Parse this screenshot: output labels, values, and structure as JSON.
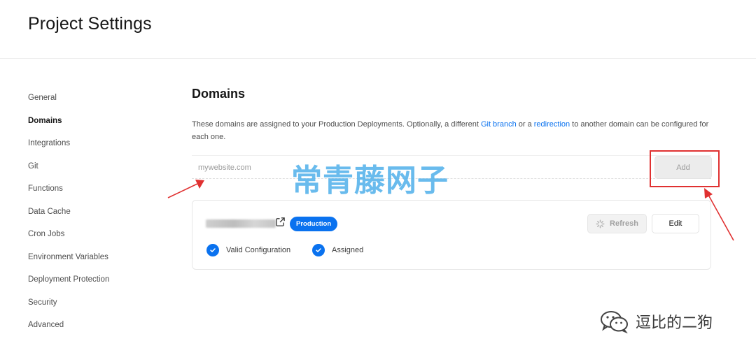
{
  "header": {
    "title": "Project Settings"
  },
  "sidebar": {
    "items": [
      {
        "label": "General"
      },
      {
        "label": "Domains",
        "active": true
      },
      {
        "label": "Integrations"
      },
      {
        "label": "Git"
      },
      {
        "label": "Functions"
      },
      {
        "label": "Data Cache"
      },
      {
        "label": "Cron Jobs"
      },
      {
        "label": "Environment Variables"
      },
      {
        "label": "Deployment Protection"
      },
      {
        "label": "Security"
      },
      {
        "label": "Advanced"
      }
    ]
  },
  "domains": {
    "title": "Domains",
    "description_before": "These domains are assigned to your Production Deployments. Optionally, a different ",
    "git_branch_link": "Git branch",
    "description_middle": " or a ",
    "redirection_link": "redirection",
    "description_after": " to another domain can be configured for each one.",
    "input": {
      "placeholder": "mywebsite.com",
      "value": ""
    },
    "add_label": "Add",
    "card": {
      "domain_icon": "external-link-icon",
      "badge": "Production",
      "refresh_label": "Refresh",
      "edit_label": "Edit",
      "status_valid": "Valid Configuration",
      "status_assigned": "Assigned"
    }
  },
  "overlay": {
    "watermark": "常青藤网子",
    "signature": "逗比的二狗"
  },
  "colors": {
    "accent": "#0a72ef",
    "annotation": "#e03131",
    "watermark": "#4fb0ea"
  }
}
